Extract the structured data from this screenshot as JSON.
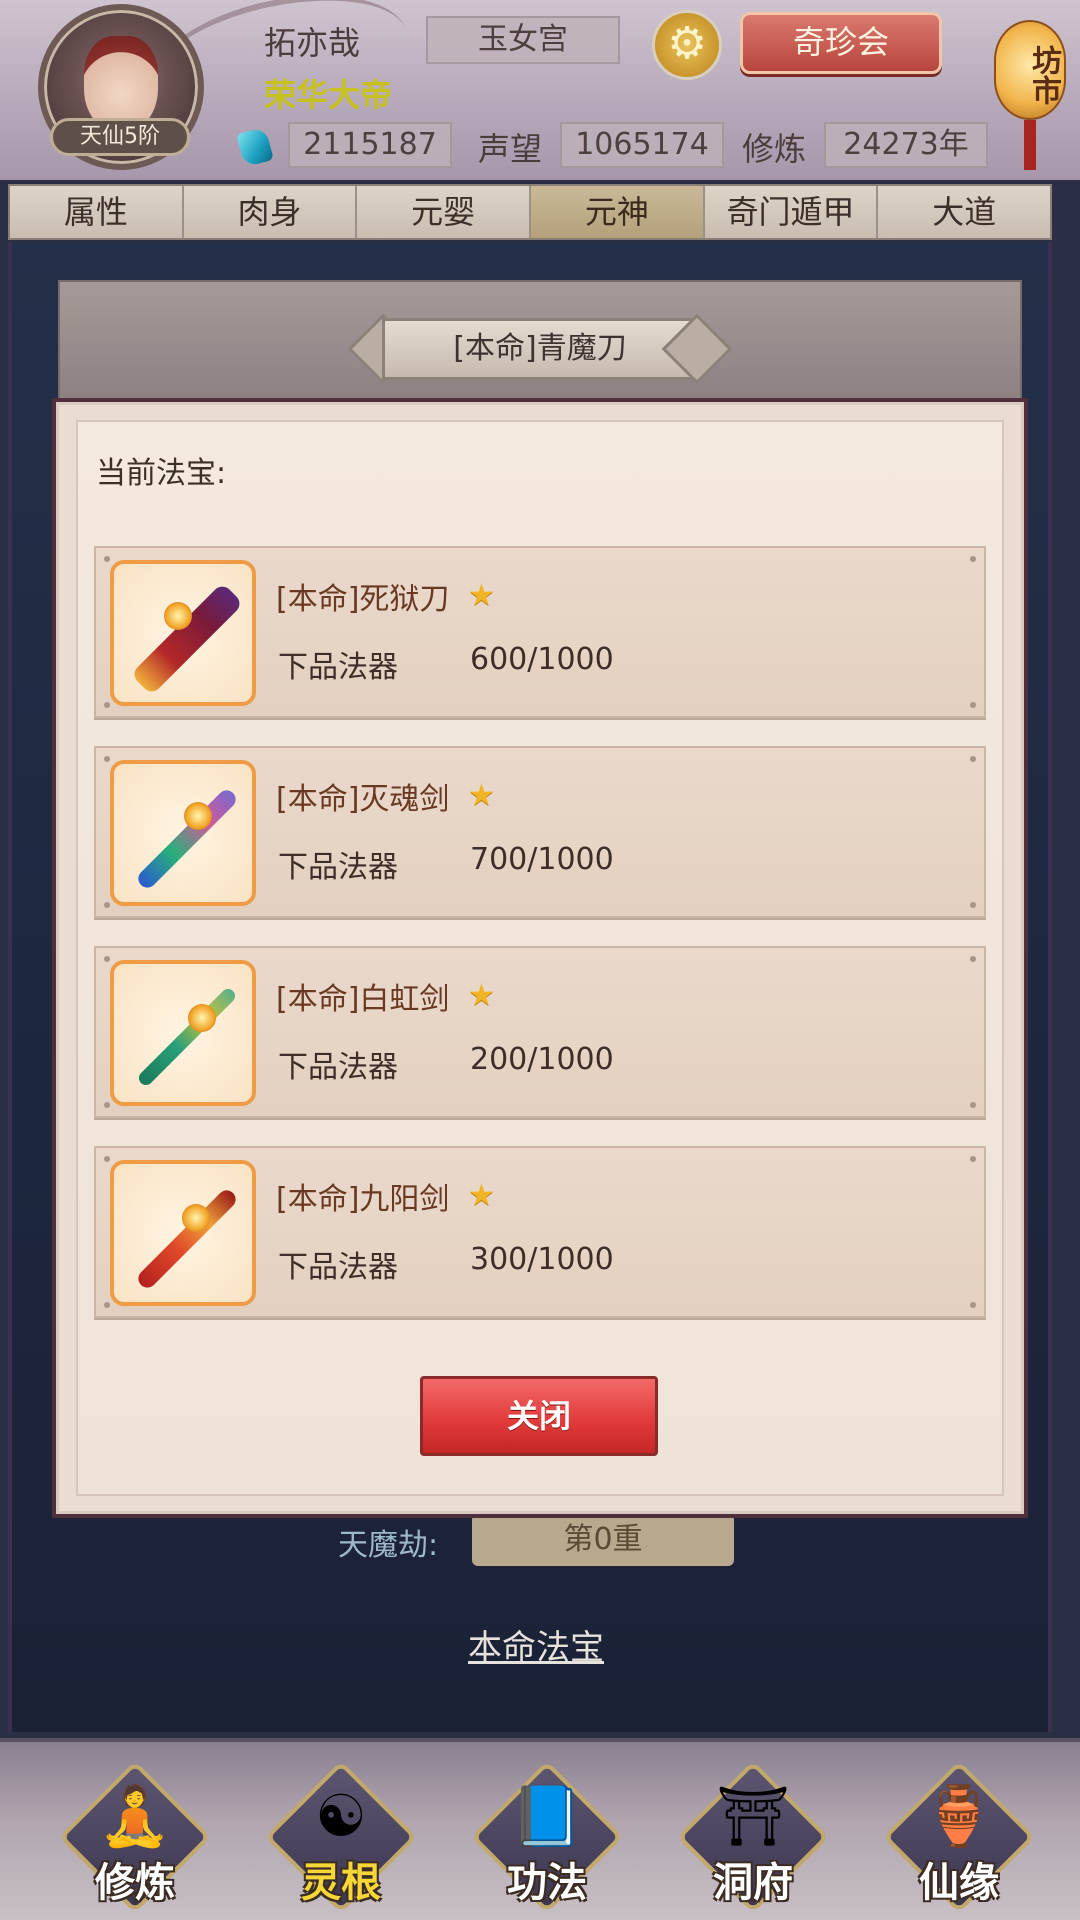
{
  "player": {
    "name": "拓亦哉",
    "title": "荣华大帝",
    "realm": "天仙5阶",
    "sect": "玉女宫"
  },
  "header": {
    "treasure_button": "奇珍会",
    "market_lantern": "坊市",
    "stats": {
      "spirit_stones": "2115187",
      "prestige_label": "声望",
      "prestige": "1065174",
      "cultivation_label": "修炼",
      "cultivation": "24273年"
    }
  },
  "tabs": [
    {
      "label": "属性",
      "active": false
    },
    {
      "label": "肉身",
      "active": false
    },
    {
      "label": "元婴",
      "active": false
    },
    {
      "label": "元神",
      "active": true
    },
    {
      "label": "奇门遁甲",
      "active": false
    },
    {
      "label": "大道",
      "active": false
    }
  ],
  "background": {
    "tribulation_label": "天魔劫:",
    "tribulation_value": "第0重",
    "link": "本命法宝"
  },
  "dialog": {
    "title": "[本命]青魔刀",
    "current_label": "当前法宝:",
    "close_button": "关闭",
    "items": [
      {
        "name": "[本命]死狱刀",
        "grade": "下品法器",
        "progress": "600/1000",
        "star_icon": "star-icon"
      },
      {
        "name": "[本命]灭魂剑",
        "grade": "下品法器",
        "progress": "700/1000",
        "star_icon": "star-icon"
      },
      {
        "name": "[本命]白虹剑",
        "grade": "下品法器",
        "progress": "200/1000",
        "star_icon": "star-icon"
      },
      {
        "name": "[本命]九阳剑",
        "grade": "下品法器",
        "progress": "300/1000",
        "star_icon": "star-icon"
      }
    ]
  },
  "bottom_nav": [
    {
      "label": "修炼",
      "active": false,
      "icon": "monk-icon"
    },
    {
      "label": "灵根",
      "active": true,
      "icon": "yin-yang-sword-icon"
    },
    {
      "label": "功法",
      "active": false,
      "icon": "book-icon"
    },
    {
      "label": "洞府",
      "active": false,
      "icon": "pagoda-icon"
    },
    {
      "label": "仙缘",
      "active": false,
      "icon": "gourd-icon"
    }
  ],
  "colors": {
    "accent_gold": "#c6c11f",
    "close_button_red": "#e23c3c",
    "item_border_orange": "#ef9c45",
    "active_nav_label": "#f7d637"
  }
}
